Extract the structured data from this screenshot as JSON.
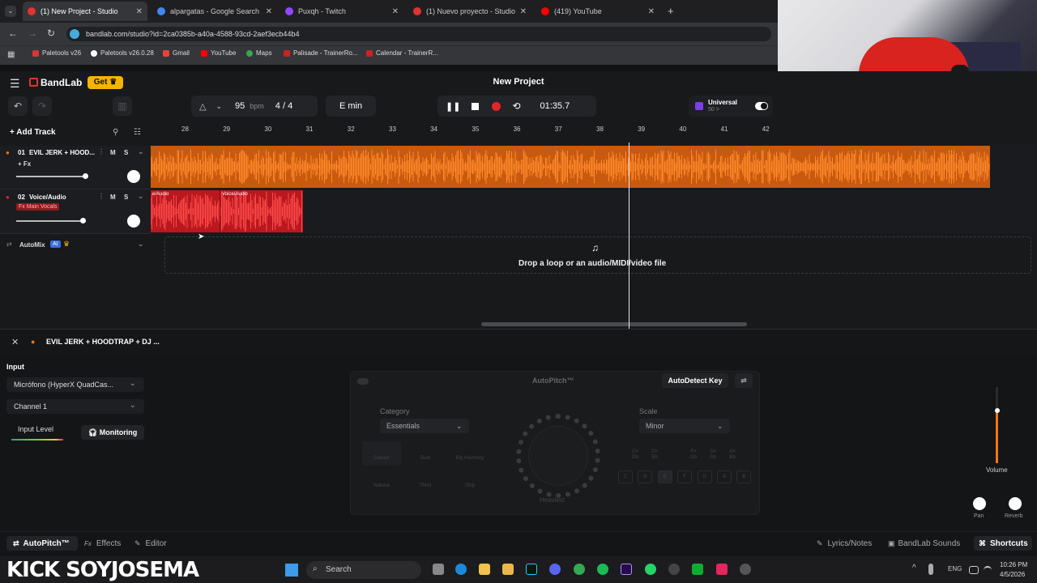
{
  "browser": {
    "tabs": [
      {
        "title": "(1) New Project - Studio",
        "active": true,
        "icon_color": "#e0342f"
      },
      {
        "title": "alpargatas - Google Search",
        "active": false,
        "icon_color": "#4285f4"
      },
      {
        "title": "Puxqh - Twitch",
        "active": false,
        "icon_color": "#9146ff"
      },
      {
        "title": "(1) Nuevo proyecto - Studio",
        "active": false,
        "icon_color": "#e0342f"
      },
      {
        "title": "(419) YouTube",
        "active": false,
        "icon_color": "#ff0000"
      }
    ],
    "url": "bandlab.com/studio?id=2ca0385b-a40a-4588-93cd-2aef3ecb44b4",
    "bookmarks": [
      "Paletools v26",
      "Paletools v26.0.28",
      "Gmail",
      "YouTube",
      "Maps",
      "Palisade - TrainerRo...",
      "Calendar - TrainerR..."
    ]
  },
  "app": {
    "brand": "BandLab",
    "get_label": "Get",
    "project_title": "New Project",
    "bpm": "95",
    "bpm_unit": "bpm",
    "time_signature": "4 / 4",
    "key": "E min",
    "time_display": "01:35.7",
    "universal_label": "Universal",
    "universal_sub": "50 >",
    "add_track_label": "Add Track",
    "ruler_ticks": [
      "28",
      "29",
      "30",
      "31",
      "32",
      "33",
      "34",
      "35",
      "36",
      "37",
      "38",
      "39",
      "40",
      "41",
      "42"
    ],
    "tracks": [
      {
        "number": "01",
        "name": "EVIL JERK + HOOD...",
        "fx": "+ Fx",
        "mute": "M",
        "solo": "S",
        "color": "#f07414"
      },
      {
        "number": "02",
        "name": "Voice/Audio",
        "fx": "Fx Main Vocals",
        "mute": "M",
        "solo": "S",
        "color": "#e0262c"
      }
    ],
    "clip_labels": [
      "e/Audio",
      "Voice/Audio"
    ],
    "automix_label": "AutoMix",
    "automix_badge": "AI",
    "drop_text": "Drop a loop or an audio/MIDI/video file"
  },
  "panel": {
    "track_title": "EVIL JERK + HOODTRAP + DJ ...",
    "input_label": "Input",
    "mic_select": "Micrófono (HyperX QuadCas...",
    "channel_select": "Channel 1",
    "input_level_label": "Input Level",
    "monitoring_label": "Monitoring",
    "autopitch_title": "AutoPitch™",
    "autodetect_label": "AutoDetect Key",
    "category_label": "Category",
    "category_value": "Essentials",
    "scale_label": "Scale",
    "scale_value": "Minor",
    "presets": [
      "Classic",
      "Duet",
      "Big Harmony",
      "Natural",
      "Third",
      "Chip"
    ],
    "knob_label": "Heaviest",
    "sharp_keys": [
      "C#\nDb",
      "D#\nEb",
      "F#\nGb",
      "G#\nAb",
      "A#\nBb"
    ],
    "natural_keys": [
      "C",
      "D",
      "E",
      "F",
      "G",
      "A",
      "B"
    ],
    "volume_label": "Volume",
    "pan_label": "Pan",
    "reverb_label": "Reverb"
  },
  "footer": {
    "autopitch_tab": "AutoPitch™",
    "effects_tab": "Effects",
    "editor_tab": "Editor",
    "lyrics_label": "Lyrics/Notes",
    "sounds_label": "BandLab Sounds",
    "shortcuts_label": "Shortcuts"
  },
  "taskbar": {
    "overlay_text": "KICK SOYJOSEMA",
    "search_label": "Search",
    "lang": "ENG",
    "time": "10:26 PM",
    "date": "4/5/2026"
  }
}
